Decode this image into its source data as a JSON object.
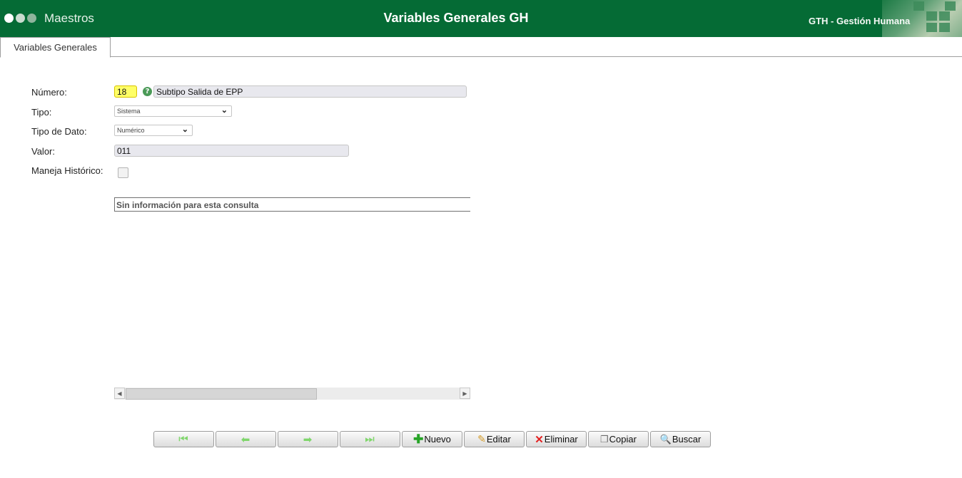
{
  "header": {
    "module": "Maestros",
    "title": "Variables Generales GH",
    "app_name": "GTH - Gestión Humana",
    "color": "#056b35"
  },
  "tabs": [
    {
      "label": "Variables Generales",
      "active": true
    }
  ],
  "form": {
    "numero": {
      "label": "Número:",
      "value": "18",
      "description": "Subtipo Salida de EPP"
    },
    "tipo": {
      "label": "Tipo:",
      "value": "Sistema"
    },
    "tipo_dato": {
      "label": "Tipo de Dato:",
      "value": "Numérico"
    },
    "valor": {
      "label": "Valor:",
      "value": "011"
    },
    "historico": {
      "label": "Maneja Histórico:",
      "checked": false
    }
  },
  "grid": {
    "empty_message": "Sin información para esta consulta"
  },
  "toolbar": {
    "nuevo": "Nuevo",
    "editar": "Editar",
    "eliminar": "Eliminar",
    "copiar": "Copiar",
    "buscar": "Buscar",
    "icons": {
      "first": "first-record-icon",
      "prev": "prev-arrow-icon",
      "next": "next-arrow-icon",
      "last": "last-record-icon",
      "nuevo": "plus-icon",
      "editar": "pencil-icon",
      "eliminar": "delete-x-icon",
      "copiar": "copy-icon",
      "buscar": "magnifier-icon"
    }
  }
}
